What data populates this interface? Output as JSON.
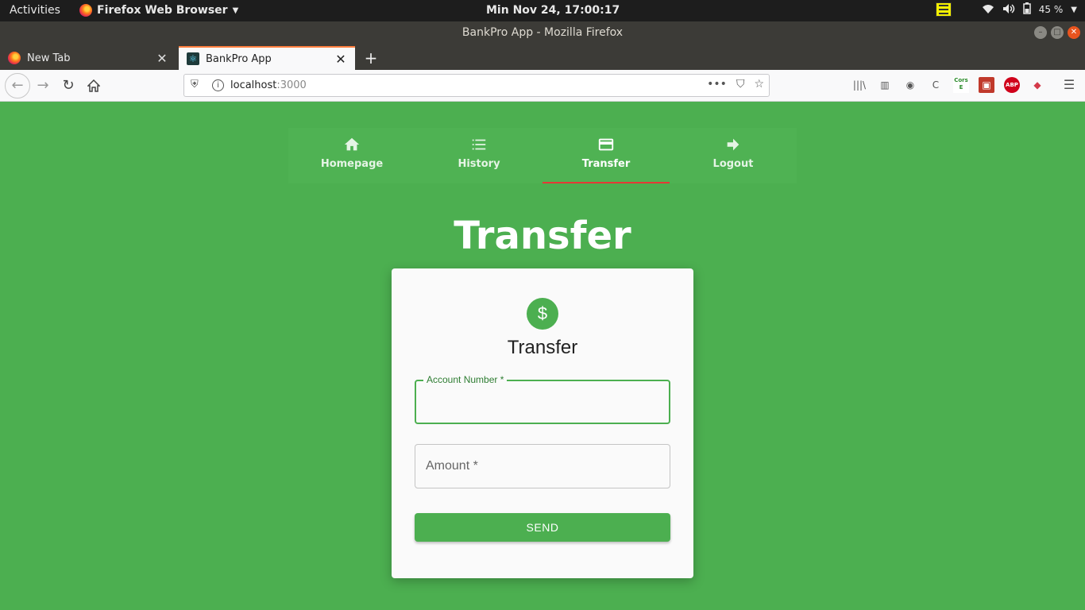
{
  "system": {
    "activities": "Activities",
    "app_menu": "Firefox Web Browser",
    "clock": "Min Nov 24, 17:00:17",
    "battery": "45 %"
  },
  "window": {
    "title": "BankPro App - Mozilla Firefox"
  },
  "tabs": [
    {
      "label": "New Tab",
      "active": false
    },
    {
      "label": "BankPro App",
      "active": true
    }
  ],
  "urlbar": {
    "host": "localhost",
    "port": ":3000"
  },
  "extensions": {
    "cors_line1": "Cors",
    "cors_line2": "E",
    "abp": "ABP"
  },
  "app_nav": [
    {
      "label": "Homepage",
      "icon": "home-icon",
      "active": false
    },
    {
      "label": "History",
      "icon": "list-icon",
      "active": false
    },
    {
      "label": "Transfer",
      "icon": "credit-card-icon",
      "active": true
    },
    {
      "label": "Logout",
      "icon": "arrow-right-icon",
      "active": false
    }
  ],
  "page": {
    "title": "Transfer"
  },
  "form": {
    "avatar_symbol": "$",
    "title": "Transfer",
    "account_label": "Account Number *",
    "account_value": "",
    "amount_label": "Amount *",
    "amount_value": "",
    "submit_label": "SEND"
  },
  "colors": {
    "primary": "#4caf50",
    "active_tab_indicator": "#e53935"
  }
}
